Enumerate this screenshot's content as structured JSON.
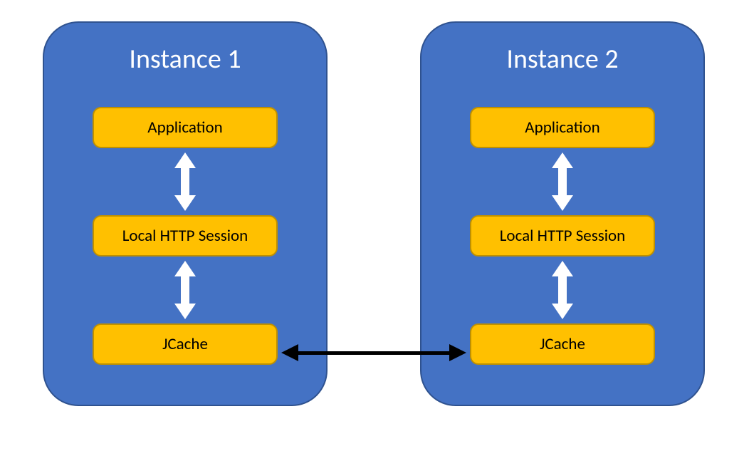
{
  "colors": {
    "instance_fill": "#4472c4",
    "instance_border": "#2f528f",
    "node_fill": "#ffc000",
    "node_border": "#bf9000",
    "inner_arrow": "#ffffff",
    "cross_arrow": "#000000"
  },
  "instances": [
    {
      "title": "Instance 1",
      "nodes": [
        "Application",
        "Local HTTP Session",
        "JCache"
      ]
    },
    {
      "title": "Instance 2",
      "nodes": [
        "Application",
        "Local HTTP Session",
        "JCache"
      ]
    }
  ],
  "connectors": {
    "inner_vertical_bidirectional": [
      {
        "between": [
          "Application",
          "Local HTTP Session"
        ]
      },
      {
        "between": [
          "Local HTTP Session",
          "JCache"
        ]
      }
    ],
    "cross_instance_bidirectional": {
      "between": [
        "Instance 1 / JCache",
        "Instance 2 / JCache"
      ]
    }
  }
}
